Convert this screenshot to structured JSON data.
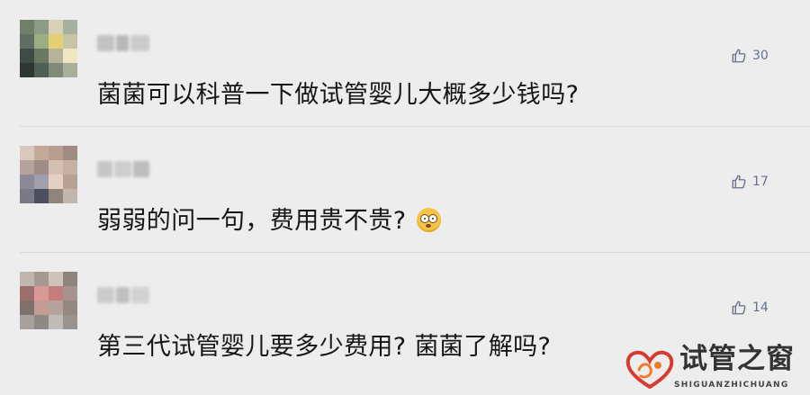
{
  "comments": [
    {
      "text": "菌菌可以科普一下做试管婴儿大概多少钱吗?",
      "likes": "30",
      "avatar_colors": [
        "#6f7f69",
        "#8c9a86",
        "#d7d2b6",
        "#a8b1a0",
        "#5f6e63",
        "#9eae84",
        "#e3cf74",
        "#c8c4a6",
        "#3f4b45",
        "#6a785f",
        "#b7b29a",
        "#efe7c4",
        "#2f3733",
        "#505f55",
        "#808a79",
        "#a9b09a"
      ],
      "name_blocks": [
        "#b5b5b5",
        "#a8a8a8",
        "#c0c0c0"
      ]
    },
    {
      "text": "弱弱的问一句，费用贵不贵?",
      "likes": "17",
      "avatar_colors": [
        "#d8c8bd",
        "#c4a999",
        "#b89e90",
        "#a08c83",
        "#b6a39b",
        "#9f8c86",
        "#d4c0b2",
        "#c7b1a4",
        "#8d8a95",
        "#a09fae",
        "#e4d1c3",
        "#b5a295",
        "#7a7a86",
        "#4d4f5e",
        "#90847e",
        "#c3b7ad"
      ],
      "name_blocks": [
        "#b9b9b9",
        "#c4c4c4",
        "#adadad"
      ],
      "emoji": "flushed-emoji"
    },
    {
      "text": "第三代试管婴儿要多少费用? 菌菌了解吗?",
      "likes": "14",
      "avatar_colors": [
        "#bfb6ae",
        "#a59a93",
        "#cfc4bb",
        "#8f847d",
        "#9c6f6c",
        "#d99a97",
        "#c47d7b",
        "#a8928d",
        "#7f706c",
        "#c59c93",
        "#b6a49c",
        "#958782",
        "#a7a09b",
        "#8d8985",
        "#c1bab5",
        "#999390"
      ],
      "name_blocks": [
        "#c0c0c0",
        "#b2b2b2",
        "#c8c8c8"
      ]
    }
  ],
  "watermark": {
    "title": "试管之窗",
    "subtitle": "SHIGUANZHICHUANG",
    "colors": {
      "heart": "#d53b2f",
      "accent": "#f07b2b",
      "text": "#333333"
    }
  },
  "colors": {
    "background": "#ededed",
    "text": "#161616",
    "like": "#66718a",
    "divider": "#d8d8d8"
  }
}
